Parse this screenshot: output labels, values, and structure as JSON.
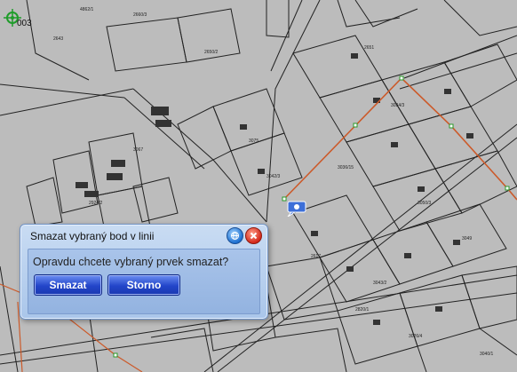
{
  "map": {
    "marker_label": "003",
    "route_color": "#cc5a2a",
    "vertex_color": "#2a9a2a",
    "marker_icon": "crosshair-marker-icon",
    "parcel_labels": [
      "4862/1",
      "2643",
      "2660/3",
      "2650/2",
      "2651",
      "3034/3",
      "3036/15",
      "3050/3",
      "2617",
      "3043/2",
      "3049",
      "3075",
      "3042/3",
      "3067",
      "2924/2",
      "2820/1",
      "3026/4",
      "3040/1"
    ]
  },
  "dialog": {
    "title": "Smazat vybraný bod v linii",
    "question": "Opravdu chcete vybraný prvek smazat?",
    "confirm_label": "Smazat",
    "cancel_label": "Storno",
    "help_icon": "help-globe-icon",
    "close_icon": "close-icon"
  }
}
